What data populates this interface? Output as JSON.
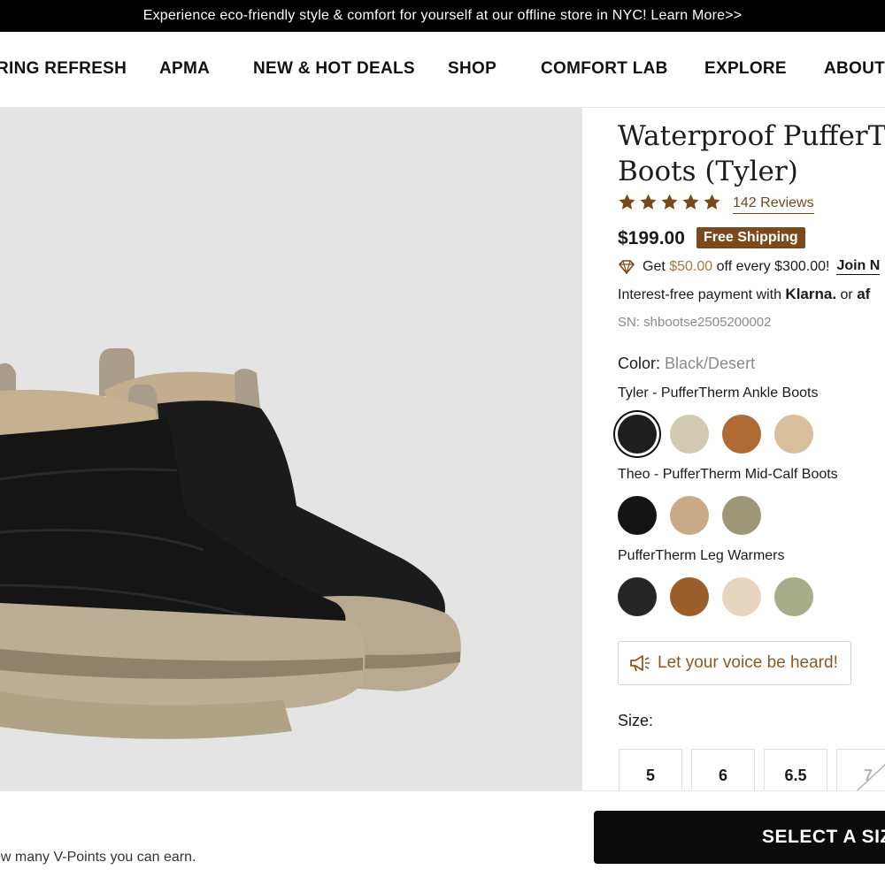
{
  "announcement": {
    "text": "Experience eco-friendly style & comfort for yourself at our offline store in NYC! Learn More>>"
  },
  "nav": {
    "items": [
      {
        "label": "RING REFRESH"
      },
      {
        "label": "APMA"
      },
      {
        "label": "NEW & HOT DEALS"
      },
      {
        "label": "SHOP"
      },
      {
        "label": "COMFORT LAB"
      },
      {
        "label": "EXPLORE"
      },
      {
        "label": "ABOUT"
      }
    ]
  },
  "product": {
    "title_line1": "Waterproof PufferTher",
    "title_line2": "Boots (Tyler)",
    "rating": 5,
    "reviews_label": "142 Reviews",
    "price": "$199.00",
    "shipping_badge": "Free Shipping",
    "promo": {
      "prefix": "Get",
      "amount": "$50.00",
      "suffix": "off every $300.00!",
      "join_label": "Join N"
    },
    "payment": {
      "prefix": "Interest-free payment with",
      "brand": "Klarna.",
      "or": "or",
      "alt_brand": "af"
    },
    "sn": "SN: shbootse2505200002",
    "color_label": "Color:",
    "color_value": "Black/Desert",
    "groups": [
      {
        "label": "Tyler - PufferTherm Ankle Boots",
        "swatches": [
          {
            "name": "black",
            "color": "#1e1e1e",
            "selected": true
          },
          {
            "name": "sage",
            "color": "#cfcab0"
          },
          {
            "name": "cognac",
            "color": "#b06a34"
          },
          {
            "name": "sand",
            "color": "#d8bf9c"
          }
        ]
      },
      {
        "label": "Theo - PufferTherm Mid-Calf Boots",
        "swatches": [
          {
            "name": "black",
            "color": "#141414"
          },
          {
            "name": "taupe",
            "color": "#c9aa88"
          },
          {
            "name": "olive",
            "color": "#9c9776"
          }
        ]
      },
      {
        "label": "PufferTherm Leg Warmers",
        "swatches": [
          {
            "name": "black",
            "color": "#262626"
          },
          {
            "name": "brown",
            "color": "#9a5e2c"
          },
          {
            "name": "cream",
            "color": "#e6d6bf"
          },
          {
            "name": "moss",
            "color": "#a7ad8a"
          }
        ]
      }
    ],
    "voice_label": "Let your voice be heard!",
    "size_label": "Size:",
    "sizes": [
      "5",
      "6",
      "6.5",
      "7"
    ]
  },
  "footer": {
    "vpoints_text": "ow many V-Points you can earn.",
    "cta_label": "SELECT A SIZE"
  }
}
